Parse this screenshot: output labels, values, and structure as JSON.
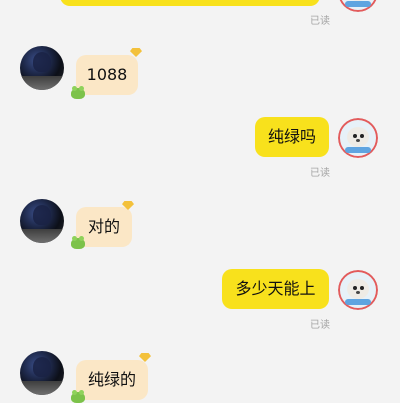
{
  "messages": [
    {
      "side": "right",
      "text": "",
      "read": "已读"
    },
    {
      "side": "left",
      "text": "1088"
    },
    {
      "side": "right",
      "text": "纯绿吗",
      "read": "已读"
    },
    {
      "side": "left",
      "text": "对的"
    },
    {
      "side": "right",
      "text": "多少天能上",
      "read": "已读"
    },
    {
      "side": "left",
      "text": "纯绿的"
    }
  ],
  "colors": {
    "background": "#f3f3f3",
    "bubble_outgoing": "#f8e11c",
    "bubble_incoming": "#fbe7c6",
    "read_receipt": "#a4a4a4"
  },
  "icons": {
    "badge": "diamond-icon",
    "decoration": "frog-icon",
    "other_avatar": "avatar",
    "own_avatar": "seal-avatar"
  }
}
